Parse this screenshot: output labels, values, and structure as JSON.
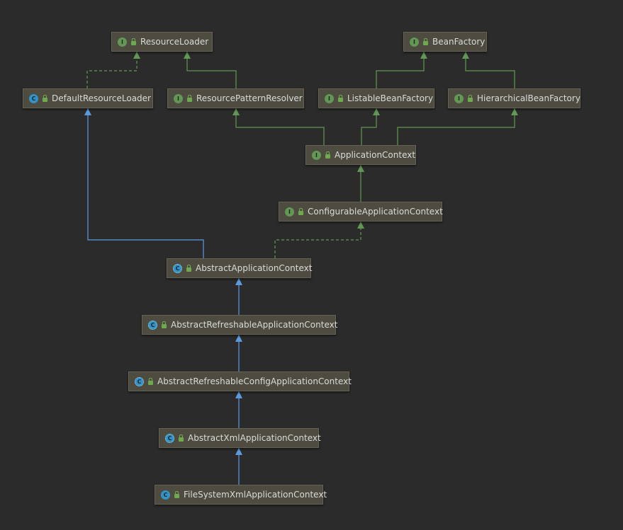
{
  "colors": {
    "background": "#2b2b2b",
    "node_fill": "#4e4b40",
    "interface_edge": "#629755",
    "inheritance_edge": "#5a9be0"
  },
  "nodes": [
    {
      "id": "resourceloader",
      "label": "ResourceLoader",
      "kind": "I",
      "kind_type": "interface"
    },
    {
      "id": "beanfactory",
      "label": "BeanFactory",
      "kind": "I",
      "kind_type": "interface"
    },
    {
      "id": "defaultresourceloader",
      "label": "DefaultResourceLoader",
      "kind": "C",
      "kind_type": "class"
    },
    {
      "id": "resourcepatternresolver",
      "label": "ResourcePatternResolver",
      "kind": "I",
      "kind_type": "interface"
    },
    {
      "id": "listablebeanfactory",
      "label": "ListableBeanFactory",
      "kind": "I",
      "kind_type": "interface"
    },
    {
      "id": "hierarchicalbeanfactory",
      "label": "HierarchicalBeanFactory",
      "kind": "I",
      "kind_type": "interface"
    },
    {
      "id": "applicationcontext",
      "label": "ApplicationContext",
      "kind": "I",
      "kind_type": "interface"
    },
    {
      "id": "configurableapplicationcontext",
      "label": "ConfigurableApplicationContext",
      "kind": "I",
      "kind_type": "interface"
    },
    {
      "id": "abstractapplicationcontext",
      "label": "AbstractApplicationContext",
      "kind": "C",
      "kind_type": "abstract"
    },
    {
      "id": "abstractrefreshableapplicationcontext",
      "label": "AbstractRefreshableApplicationContext",
      "kind": "C",
      "kind_type": "abstract"
    },
    {
      "id": "abstractrefreshableconfigapplicationcontext",
      "label": "AbstractRefreshableConfigApplicationContext",
      "kind": "C",
      "kind_type": "abstract"
    },
    {
      "id": "abstractxmlapplicationcontext",
      "label": "AbstractXmlApplicationContext",
      "kind": "C",
      "kind_type": "abstract"
    },
    {
      "id": "filesystemxmlapplicationcontext",
      "label": "FileSystemXmlApplicationContext",
      "kind": "C",
      "kind_type": "class"
    }
  ],
  "edges": [
    {
      "from": "defaultresourceloader",
      "to": "resourceloader",
      "relation": "implements"
    },
    {
      "from": "resourcepatternresolver",
      "to": "resourceloader",
      "relation": "extends-interface"
    },
    {
      "from": "listablebeanfactory",
      "to": "beanfactory",
      "relation": "extends-interface"
    },
    {
      "from": "hierarchicalbeanfactory",
      "to": "beanfactory",
      "relation": "extends-interface"
    },
    {
      "from": "applicationcontext",
      "to": "resourcepatternresolver",
      "relation": "extends-interface"
    },
    {
      "from": "applicationcontext",
      "to": "listablebeanfactory",
      "relation": "extends-interface"
    },
    {
      "from": "applicationcontext",
      "to": "hierarchicalbeanfactory",
      "relation": "extends-interface"
    },
    {
      "from": "configurableapplicationcontext",
      "to": "applicationcontext",
      "relation": "extends-interface"
    },
    {
      "from": "abstractapplicationcontext",
      "to": "configurableapplicationcontext",
      "relation": "implements"
    },
    {
      "from": "abstractapplicationcontext",
      "to": "defaultresourceloader",
      "relation": "extends"
    },
    {
      "from": "abstractrefreshableapplicationcontext",
      "to": "abstractapplicationcontext",
      "relation": "extends"
    },
    {
      "from": "abstractrefreshableconfigapplicationcontext",
      "to": "abstractrefreshableapplicationcontext",
      "relation": "extends"
    },
    {
      "from": "abstractxmlapplicationcontext",
      "to": "abstractrefreshableconfigapplicationcontext",
      "relation": "extends"
    },
    {
      "from": "filesystemxmlapplicationcontext",
      "to": "abstractxmlapplicationcontext",
      "relation": "extends"
    }
  ]
}
